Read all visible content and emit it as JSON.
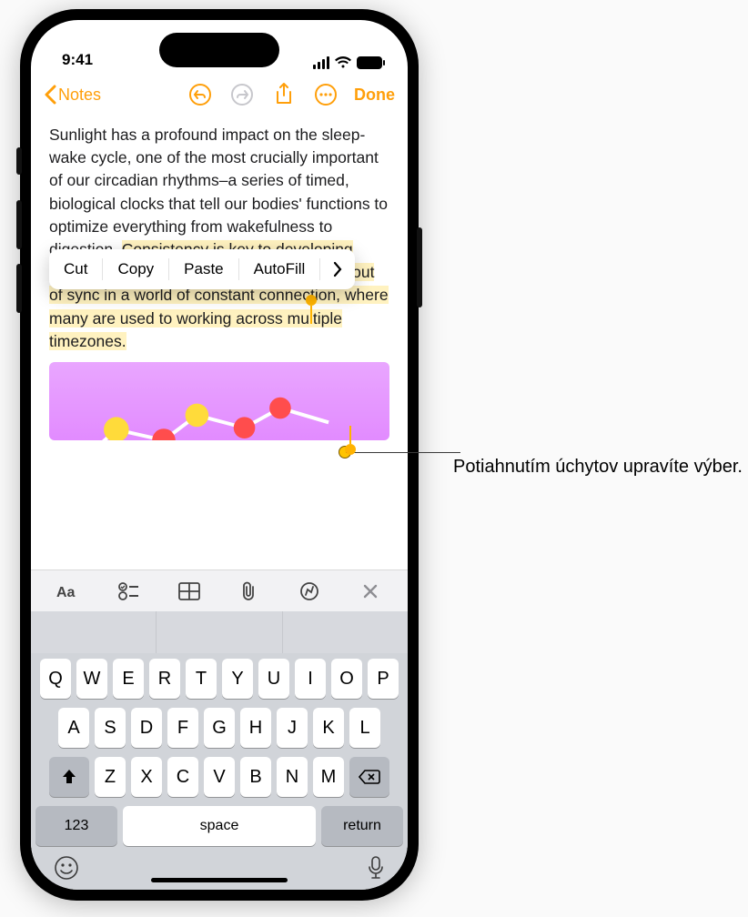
{
  "status": {
    "time": "9:41"
  },
  "nav": {
    "back_label": "Notes",
    "done_label": "Done"
  },
  "note": {
    "text_before": "Sunlight has a profound impact on the sleep-wake cycle, one of the most crucially important of our circadian rhythms–a series of     timed, biological clocks that tell our bodies' functions to optimize everything from wakefulness to digestion. ",
    "text_selected": "Consistency is key to developing healthy sleep patterns, and it's easy to slip out of sync in a world of constant connection, where many are used to working across multiple timezones."
  },
  "edit_menu": {
    "items": [
      "Cut",
      "Copy",
      "Paste",
      "AutoFill"
    ]
  },
  "format_bar": {
    "icons": [
      "text-format-icon",
      "checklist-icon",
      "table-icon",
      "attachment-icon",
      "markup-icon",
      "close-icon"
    ]
  },
  "keyboard": {
    "row1": [
      "Q",
      "W",
      "E",
      "R",
      "T",
      "Y",
      "U",
      "I",
      "O",
      "P"
    ],
    "row2": [
      "A",
      "S",
      "D",
      "F",
      "G",
      "H",
      "J",
      "K",
      "L"
    ],
    "row3": [
      "Z",
      "X",
      "C",
      "V",
      "B",
      "N",
      "M"
    ],
    "numkey": "123",
    "space": "space",
    "return": "return"
  },
  "callout": {
    "text": "Potiahnutím úchytov upravíte výber."
  }
}
